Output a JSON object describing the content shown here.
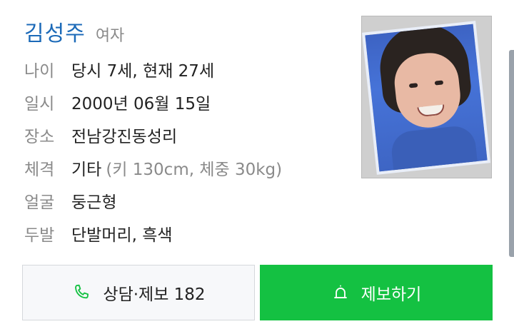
{
  "person": {
    "name": "김성주",
    "gender": "여자"
  },
  "details": [
    {
      "label": "나이",
      "value": "당시 7세, 현재 27세",
      "note": ""
    },
    {
      "label": "일시",
      "value": "2000년 06월 15일",
      "note": ""
    },
    {
      "label": "장소",
      "value": "전남강진동성리",
      "note": ""
    },
    {
      "label": "체격",
      "value": "기타",
      "note": "(키 130cm, 체중 30kg)"
    },
    {
      "label": "얼굴",
      "value": "둥근형",
      "note": ""
    },
    {
      "label": "두발",
      "value": "단발머리, 흑색",
      "note": ""
    }
  ],
  "buttons": {
    "call_label": "상담·제보 182",
    "report_label": "제보하기"
  },
  "icons": {
    "call": "phone-icon",
    "report": "siren-icon"
  },
  "colors": {
    "name": "#1c6ab8",
    "report_button": "#14c142",
    "call_icon": "#14c142"
  }
}
